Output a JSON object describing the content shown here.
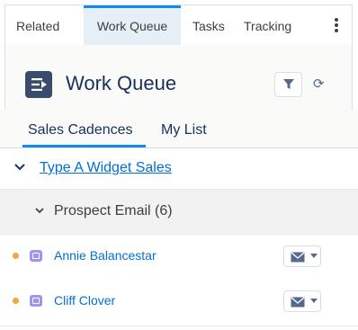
{
  "top_tabs": [
    {
      "label": "Related",
      "active": false
    },
    {
      "label": "Work Queue",
      "active": true
    },
    {
      "label": "Tasks",
      "active": false
    },
    {
      "label": "Tracking",
      "active": false
    }
  ],
  "header": {
    "title": "Work Queue"
  },
  "sub_tabs": [
    {
      "label": "Sales Cadences",
      "active": true
    },
    {
      "label": "My List",
      "active": false
    }
  ],
  "cadence": {
    "label": "Type A Widget Sales"
  },
  "step": {
    "label": "Prospect Email (6)"
  },
  "contacts": [
    {
      "name": "Annie Balancestar"
    },
    {
      "name": "Cliff Clover"
    }
  ],
  "colors": {
    "accent": "#1589ee",
    "link": "#0070d2",
    "priority_dot": "#f4a53b",
    "contact_icon": "#a094ed",
    "header_icon": "#3b4b6b"
  },
  "icons": [
    "kebab-menu-icon",
    "work-queue-icon",
    "filter-icon",
    "refresh-icon",
    "chevron-down-icon",
    "contact-icon",
    "email-icon",
    "dropdown-arrow-icon"
  ]
}
